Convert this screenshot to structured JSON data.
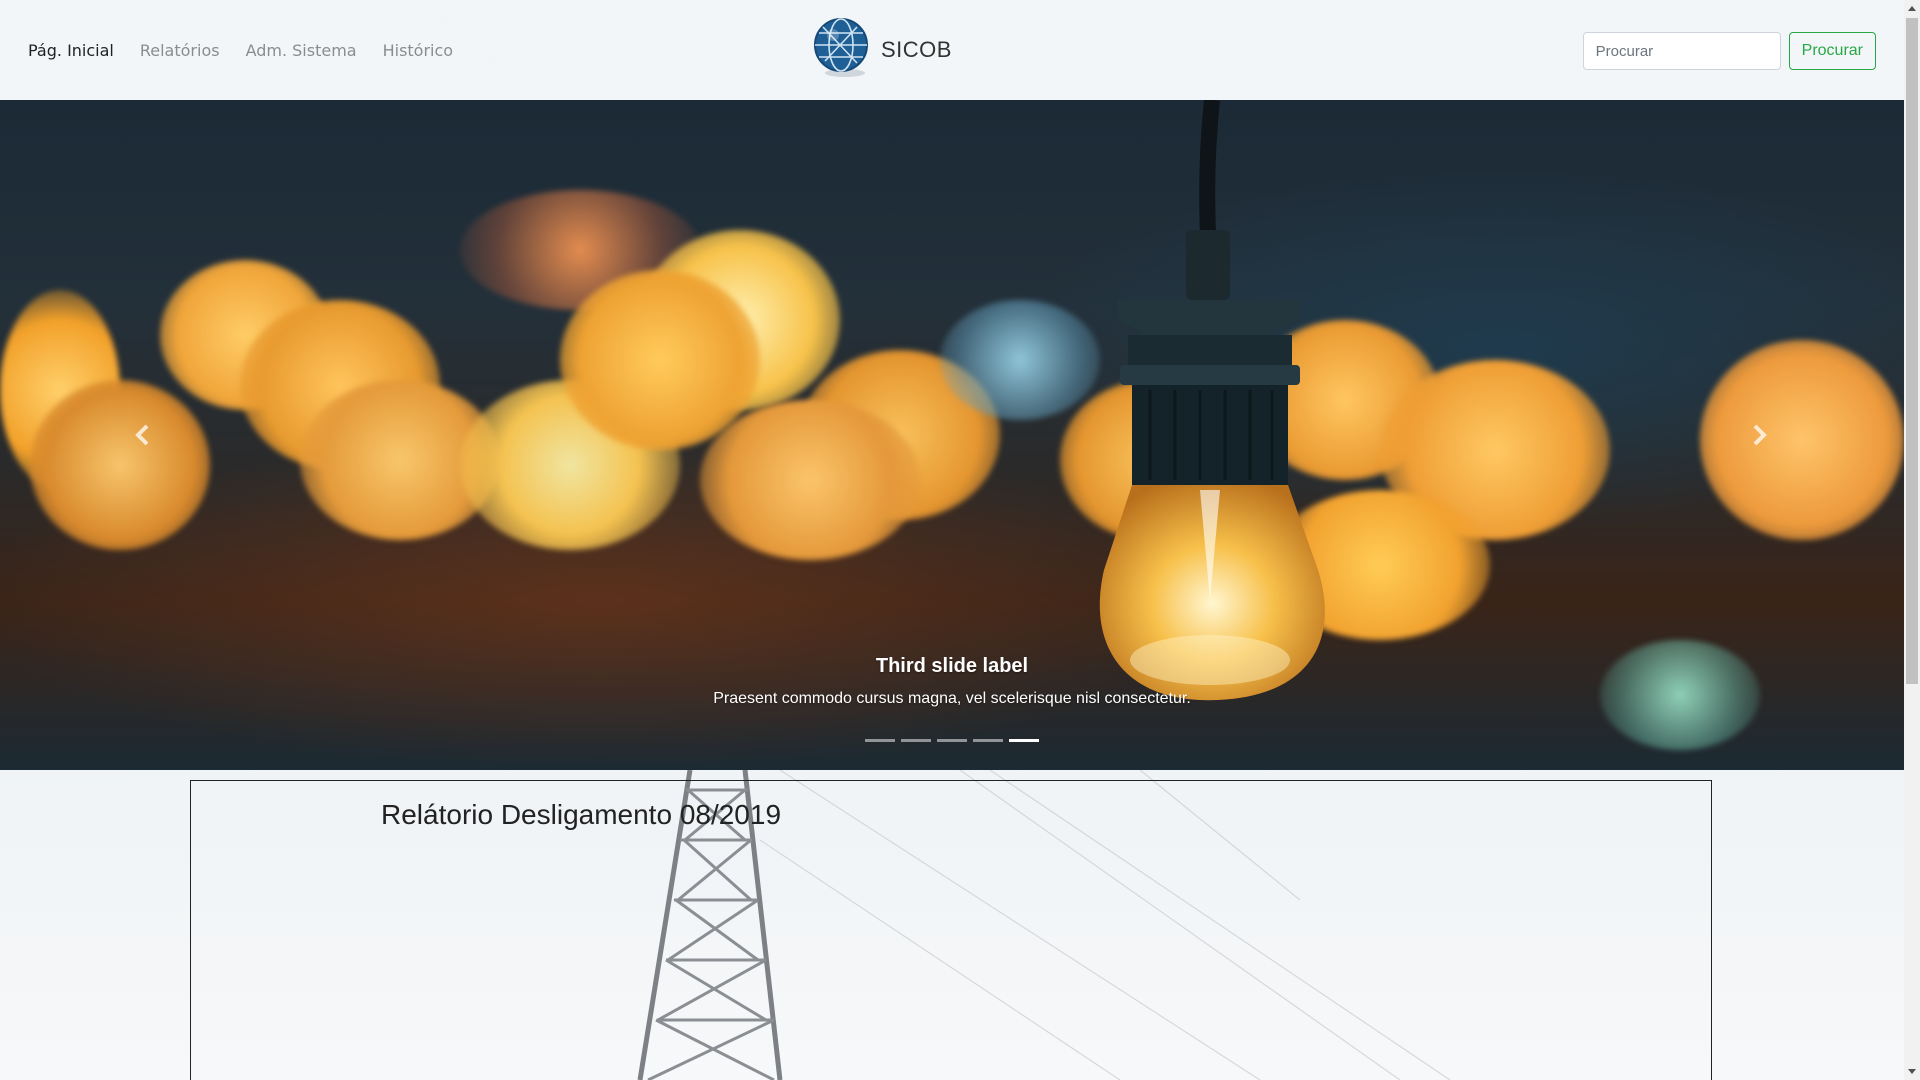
{
  "nav": {
    "links": [
      {
        "label": "Pág. Inicial"
      },
      {
        "label": "Relatórios"
      },
      {
        "label": "Adm. Sistema"
      },
      {
        "label": "Histórico"
      }
    ],
    "brand_name": "SICOB",
    "brand_icon": "globe-icon"
  },
  "search": {
    "placeholder": "Procurar",
    "value": "",
    "button_label": "Procurar"
  },
  "carousel": {
    "caption_title": "Third slide label",
    "caption_text": "Praesent commodo cursus magna, vel scelerisque nisl consectetur.",
    "slide_count": 5,
    "active_slide": 5,
    "prev_icon": "chevron-left-icon",
    "next_icon": "chevron-right-icon"
  },
  "report": {
    "title": "Relátorio Desligamento 08/2019"
  },
  "colors": {
    "success": "#28a745",
    "active_link": "#222222",
    "inactive_link": "#8a8d90"
  }
}
